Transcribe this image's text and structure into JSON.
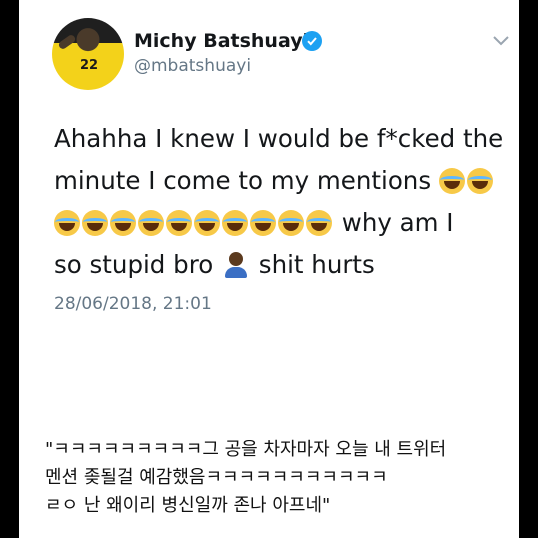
{
  "tweet": {
    "name": "Michy Batshuayi",
    "handle": "@mbatshuayi",
    "avatar_number": "22",
    "lines": [
      {
        "before": "Ahahha I knew I would be f*cked the",
        "emoji_count": 0,
        "after": ""
      },
      {
        "before": "minute I come to my mentions ",
        "emoji_count": 2,
        "after": ""
      },
      {
        "before": "",
        "emoji_count": 10,
        "after": " why am I"
      },
      {
        "before": "so stupid bro ",
        "person": true,
        "after": " shit hurts"
      }
    ],
    "timestamp": "28/06/2018, 21:01"
  },
  "caption": {
    "lines": [
      "\"ㅋㅋㅋㅋㅋㅋㅋㅋㅋ그 공을 차자마자 오늘 내 트위터",
      "멘션 좆될걸 예감했음ㅋㅋㅋㅋㅋㅋㅋㅋㅋㅋㅋ",
      "ㄹㅇ 난 왜이리 병신일까 존나 아프네\""
    ]
  },
  "colors": {
    "verified": "#1da1f2",
    "text": "#14171a",
    "muted": "#657786",
    "background": "#000000"
  },
  "icons": [
    "verified-badge-icon",
    "chevron-down-icon",
    "laughing-crying-emoji",
    "person-emoji"
  ]
}
